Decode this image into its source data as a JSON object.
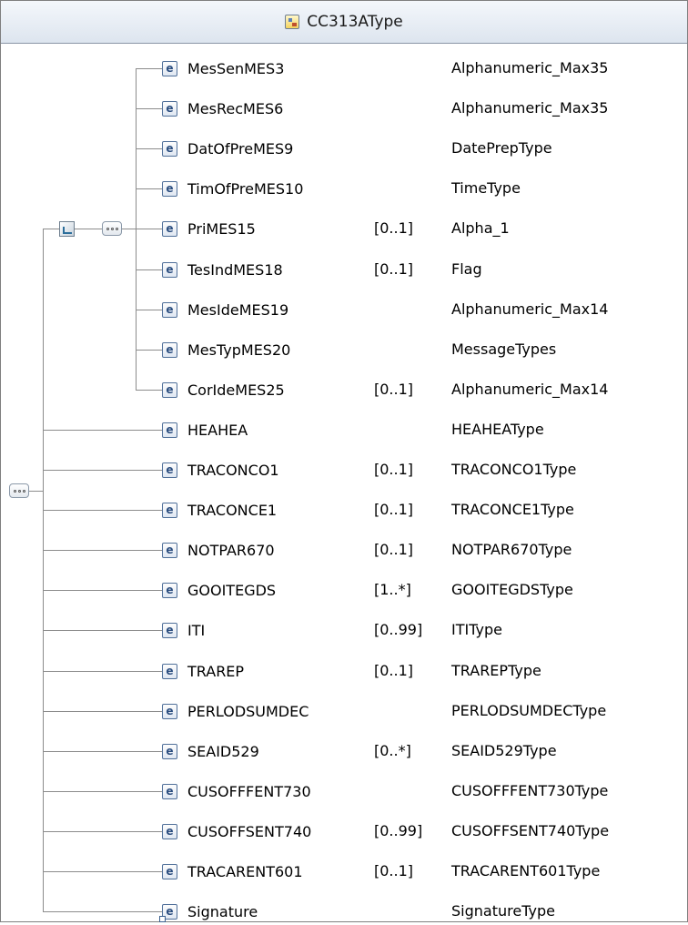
{
  "type_title": "CC313AType",
  "icons": {
    "type_icon": "complex-type-icon",
    "element_icon": "element-icon",
    "element_ref_icon": "element-reference-icon",
    "compositor_icon": "sequence-compositor-icon",
    "group_ref_icon": "group-reference-icon"
  },
  "element_icon_letter": "e",
  "group_rows": [
    {
      "name": "MesSenMES3",
      "occurs": "",
      "type": "Alphanumeric_Max35"
    },
    {
      "name": "MesRecMES6",
      "occurs": "",
      "type": "Alphanumeric_Max35"
    },
    {
      "name": "DatOfPreMES9",
      "occurs": "",
      "type": "DatePrepType"
    },
    {
      "name": "TimOfPreMES10",
      "occurs": "",
      "type": "TimeType"
    },
    {
      "name": "PriMES15",
      "occurs": "[0..1]",
      "type": "Alpha_1"
    },
    {
      "name": "TesIndMES18",
      "occurs": "[0..1]",
      "type": "Flag"
    },
    {
      "name": "MesIdeMES19",
      "occurs": "",
      "type": "Alphanumeric_Max14"
    },
    {
      "name": "MesTypMES20",
      "occurs": "",
      "type": "MessageTypes"
    },
    {
      "name": "CorIdeMES25",
      "occurs": "[0..1]",
      "type": "Alphanumeric_Max14"
    }
  ],
  "main_rows": [
    {
      "name": "HEAHEA",
      "occurs": "",
      "type": "HEAHEAType"
    },
    {
      "name": "TRACONCO1",
      "occurs": "[0..1]",
      "type": "TRACONCO1Type"
    },
    {
      "name": "TRACONCE1",
      "occurs": "[0..1]",
      "type": "TRACONCE1Type"
    },
    {
      "name": "NOTPAR670",
      "occurs": "[0..1]",
      "type": "NOTPAR670Type"
    },
    {
      "name": "GOOITEGDS",
      "occurs": "[1..*]",
      "type": "GOOITEGDSType"
    },
    {
      "name": "ITI",
      "occurs": "[0..99]",
      "type": "ITIType"
    },
    {
      "name": "TRAREP",
      "occurs": "[0..1]",
      "type": "TRAREPType"
    },
    {
      "name": "PERLODSUMDEC",
      "occurs": "",
      "type": "PERLODSUMDECType"
    },
    {
      "name": "SEAID529",
      "occurs": "[0..*]",
      "type": "SEAID529Type"
    },
    {
      "name": "CUSOFFFENT730",
      "occurs": "",
      "type": "CUSOFFFENT730Type"
    },
    {
      "name": "CUSOFFSENT740",
      "occurs": "[0..99]",
      "type": "CUSOFFSENT740Type"
    },
    {
      "name": "TRACARENT601",
      "occurs": "[0..1]",
      "type": "TRACARENT601Type"
    },
    {
      "name": "Signature",
      "occurs": "",
      "type": "SignatureType",
      "is_ref": true
    }
  ]
}
